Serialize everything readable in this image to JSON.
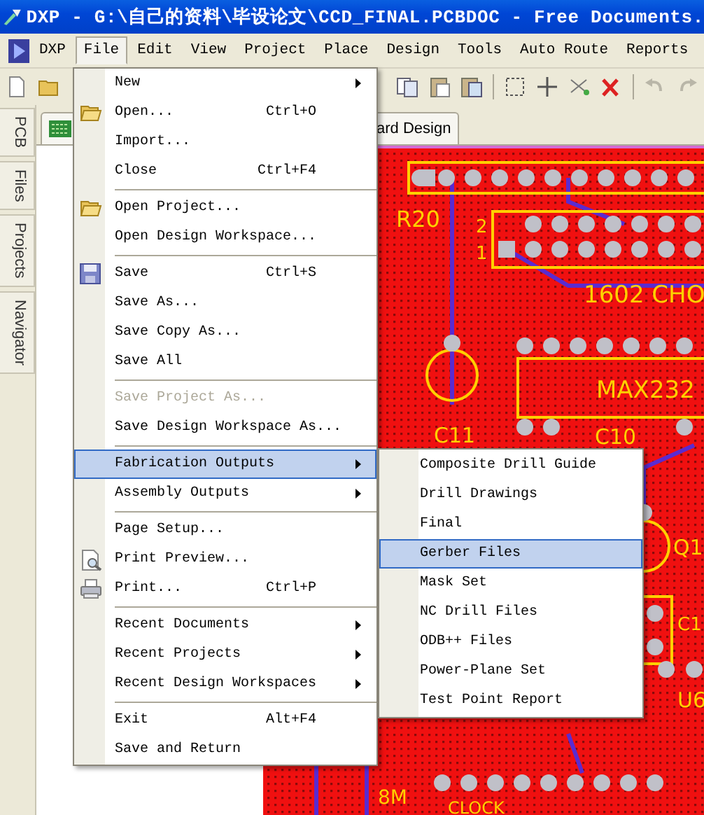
{
  "window": {
    "title": "DXP - G:\\自己的资料\\毕设论文\\CCD_FINAL.PCBDOC - Free Documents."
  },
  "menubar": {
    "app": "DXP",
    "items": [
      {
        "label": "File",
        "selected": true
      },
      {
        "label": "Edit",
        "selected": false
      },
      {
        "label": "View",
        "selected": false
      },
      {
        "label": "Project",
        "selected": false
      },
      {
        "label": "Place",
        "selected": false
      },
      {
        "label": "Design",
        "selected": false
      },
      {
        "label": "Tools",
        "selected": false
      },
      {
        "label": "Auto Route",
        "selected": false
      },
      {
        "label": "Reports",
        "selected": false
      }
    ]
  },
  "side_tabs": [
    {
      "label": "PCB"
    },
    {
      "label": "Files"
    },
    {
      "label": "Projects"
    },
    {
      "label": "Navigator"
    }
  ],
  "document_tabs": [
    {
      "kind": "icon"
    },
    {
      "kind": "text",
      "label": "ard Design"
    }
  ],
  "file_menu": {
    "items": [
      {
        "kind": "item",
        "label": "New",
        "submenu": true,
        "disabled": false,
        "selected": false
      },
      {
        "kind": "item",
        "label": "Open...",
        "shortcut": "Ctrl+O",
        "submenu": false,
        "disabled": false,
        "selected": false
      },
      {
        "kind": "item",
        "label": "Import...",
        "submenu": false,
        "disabled": false,
        "selected": false
      },
      {
        "kind": "item",
        "label": "Close",
        "shortcut": "Ctrl+F4",
        "submenu": false,
        "disabled": false,
        "selected": false
      },
      {
        "kind": "separator"
      },
      {
        "kind": "item",
        "label": "Open Project...",
        "submenu": false,
        "disabled": false,
        "selected": false
      },
      {
        "kind": "item",
        "label": "Open Design Workspace...",
        "submenu": false,
        "disabled": false,
        "selected": false
      },
      {
        "kind": "separator"
      },
      {
        "kind": "item",
        "label": "Save",
        "shortcut": "Ctrl+S",
        "submenu": false,
        "disabled": false,
        "selected": false
      },
      {
        "kind": "item",
        "label": "Save As...",
        "submenu": false,
        "disabled": false,
        "selected": false
      },
      {
        "kind": "item",
        "label": "Save Copy As...",
        "submenu": false,
        "disabled": false,
        "selected": false
      },
      {
        "kind": "item",
        "label": "Save All",
        "submenu": false,
        "disabled": false,
        "selected": false
      },
      {
        "kind": "separator"
      },
      {
        "kind": "item",
        "label": "Save Project As...",
        "submenu": false,
        "disabled": true,
        "selected": false
      },
      {
        "kind": "item",
        "label": "Save Design Workspace As...",
        "submenu": false,
        "disabled": false,
        "selected": false
      },
      {
        "kind": "separator"
      },
      {
        "kind": "item",
        "label": "Fabrication Outputs",
        "submenu": true,
        "disabled": false,
        "selected": true
      },
      {
        "kind": "item",
        "label": "Assembly Outputs",
        "submenu": true,
        "disabled": false,
        "selected": false
      },
      {
        "kind": "separator"
      },
      {
        "kind": "item",
        "label": "Page Setup...",
        "submenu": false,
        "disabled": false,
        "selected": false
      },
      {
        "kind": "item",
        "label": "Print Preview...",
        "submenu": false,
        "disabled": false,
        "selected": false
      },
      {
        "kind": "item",
        "label": "Print...",
        "shortcut": "Ctrl+P",
        "submenu": false,
        "disabled": false,
        "selected": false
      },
      {
        "kind": "separator"
      },
      {
        "kind": "item",
        "label": "Recent Documents",
        "submenu": true,
        "disabled": false,
        "selected": false
      },
      {
        "kind": "item",
        "label": "Recent Projects",
        "submenu": true,
        "disabled": false,
        "selected": false
      },
      {
        "kind": "item",
        "label": "Recent Design Workspaces",
        "submenu": true,
        "disabled": false,
        "selected": false
      },
      {
        "kind": "separator"
      },
      {
        "kind": "item",
        "label": "Exit",
        "shortcut": "Alt+F4",
        "submenu": false,
        "disabled": false,
        "selected": false
      },
      {
        "kind": "item",
        "label": "Save and Return",
        "submenu": false,
        "disabled": false,
        "selected": false
      }
    ]
  },
  "fabrication_submenu": {
    "items": [
      {
        "label": "Composite Drill Guide",
        "selected": false
      },
      {
        "label": "Drill Drawings",
        "selected": false
      },
      {
        "label": "Final",
        "selected": false
      },
      {
        "label": "Gerber Files",
        "selected": true
      },
      {
        "label": "Mask Set",
        "selected": false
      },
      {
        "label": "NC Drill Files",
        "selected": false
      },
      {
        "label": "ODB++ Files",
        "selected": false
      },
      {
        "label": "Power-Plane Set",
        "selected": false
      },
      {
        "label": "Test Point Report",
        "selected": false
      }
    ]
  },
  "pcb": {
    "labels": [
      "R20",
      "2",
      "1",
      "1602 CHO",
      "MAX232",
      "C11",
      "C10",
      "Q1",
      "C1",
      "U6",
      "8M",
      "CLOCK"
    ]
  }
}
